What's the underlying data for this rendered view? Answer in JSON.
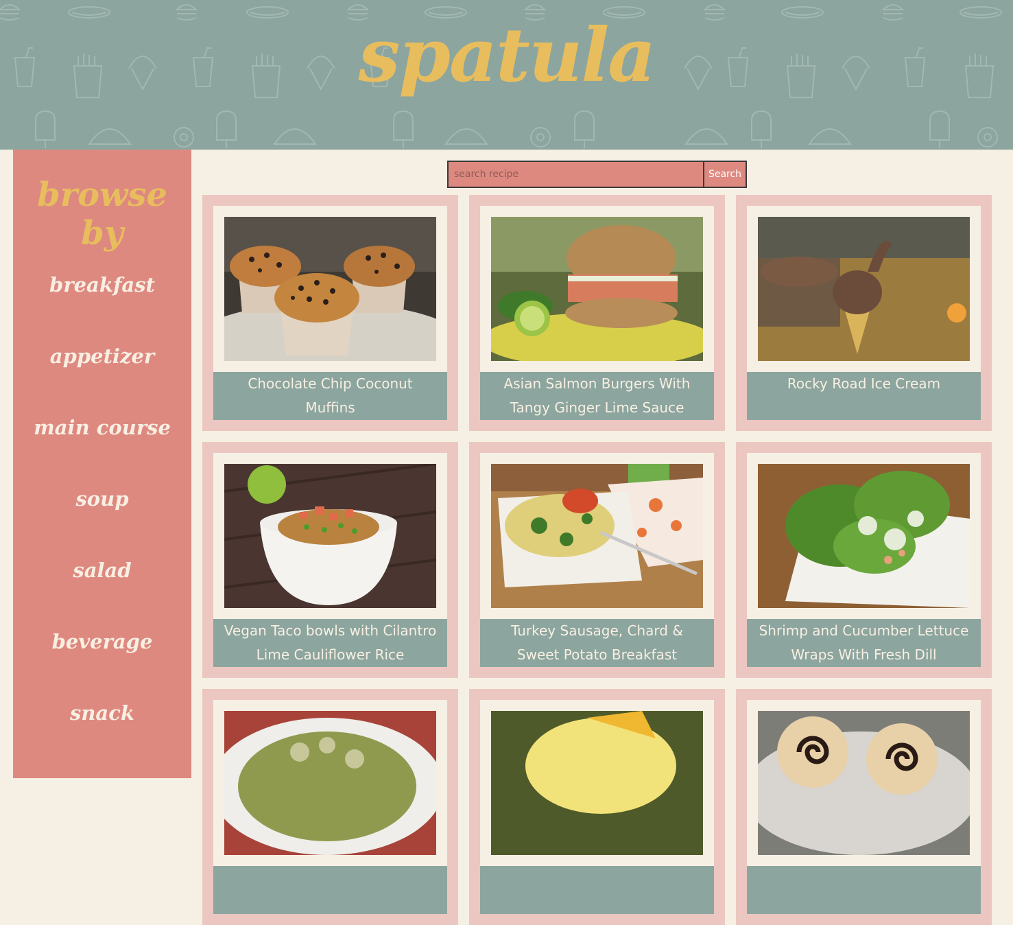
{
  "header": {
    "logo": "spatula"
  },
  "sidebar": {
    "title": "browse by",
    "items": [
      {
        "label": "breakfast"
      },
      {
        "label": "appetizer"
      },
      {
        "label": "main course"
      },
      {
        "label": "soup"
      },
      {
        "label": "salad"
      },
      {
        "label": "beverage"
      },
      {
        "label": "snack"
      }
    ]
  },
  "search": {
    "placeholder": "search recipe",
    "button_label": "Search"
  },
  "recipes": [
    {
      "title": "Chocolate Chip Coconut Muffins",
      "image": "muffins"
    },
    {
      "title": "Asian Salmon Burgers With Tangy Ginger Lime Sauce",
      "image": "burger"
    },
    {
      "title": "Rocky Road Ice Cream",
      "image": "ice-cream-cone"
    },
    {
      "title": "Vegan Taco bowls with Cilantro Lime Cauliflower Rice",
      "image": "taco-bowl"
    },
    {
      "title": "Turkey Sausage, Chard & Sweet Potato Breakfast Scramble",
      "image": "scramble"
    },
    {
      "title": "Shrimp and Cucumber Lettuce Wraps With Fresh Dill",
      "image": "lettuce-wraps"
    },
    {
      "title": "",
      "image": "potato-salad"
    },
    {
      "title": "",
      "image": "mango-sorbet"
    },
    {
      "title": "",
      "image": "pinwheel-cookies"
    }
  ],
  "colors": {
    "header_bg": "#8ca59e",
    "logo": "#e8bd5e",
    "sidebar_bg": "#de8980",
    "card_bg": "#ecc7c1",
    "page_bg": "#f6efe4"
  }
}
